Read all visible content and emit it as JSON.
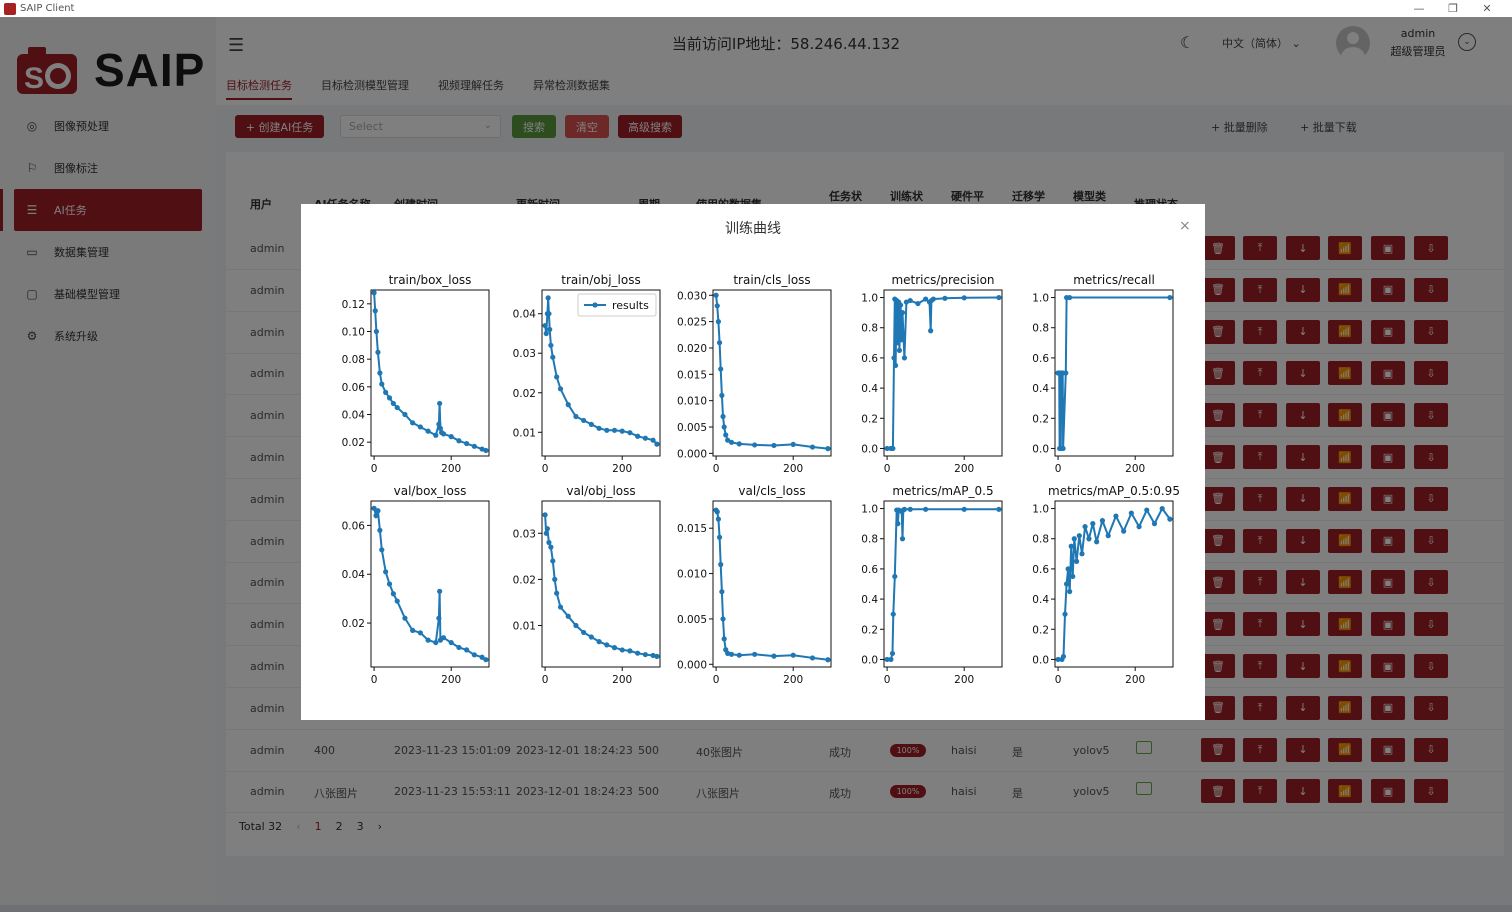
{
  "window": {
    "title": "SAIP Client"
  },
  "brand": {
    "logo_text": "SAIP"
  },
  "sidebar": {
    "items": [
      {
        "label": "图像预处理",
        "icon": "compass-icon"
      },
      {
        "label": "图像标注",
        "icon": "flag-icon"
      },
      {
        "label": "AI任务",
        "icon": "sliders-icon",
        "active": true
      },
      {
        "label": "数据集管理",
        "icon": "presentation-icon"
      },
      {
        "label": "基础模型管理",
        "icon": "folder-icon"
      },
      {
        "label": "系统升级",
        "icon": "gear-icon"
      }
    ]
  },
  "header": {
    "ip_title": "当前访问IP地址：58.246.44.132",
    "language": "中文（简体）",
    "user_name": "admin",
    "user_role": "超级管理员",
    "tabs": [
      "目标检测任务",
      "目标检测模型管理",
      "视频理解任务",
      "异常检测数据集"
    ]
  },
  "toolbar": {
    "create_label": "+ 创建AI任务",
    "select_placeholder": "Select",
    "search_label": "搜索",
    "clear_label": "清空",
    "advanced_label": "高级搜索",
    "batch_delete_label": "+ 批量删除",
    "batch_download_label": "+ 批量下载"
  },
  "table": {
    "columns": [
      "用户",
      "AI任务名称",
      "创建时间",
      "更新时间",
      "周期",
      "使用的数据集",
      "任务状",
      "训练状",
      "硬件平",
      "迁移学",
      "模型类",
      "推理状态"
    ],
    "rows": [
      {
        "user": "admin"
      },
      {
        "user": "admin"
      },
      {
        "user": "admin"
      },
      {
        "user": "admin"
      },
      {
        "user": "admin"
      },
      {
        "user": "admin"
      },
      {
        "user": "admin"
      },
      {
        "user": "admin"
      },
      {
        "user": "admin"
      },
      {
        "user": "admin"
      },
      {
        "user": "admin"
      },
      {
        "user": "admin"
      },
      {
        "user": "admin",
        "name": "400",
        "created": "2023-11-23 15:01:09",
        "updated": "2023-12-01 18:24:23",
        "epochs": "500",
        "dataset": "40张图片",
        "status": "成功",
        "progress": "100%",
        "hardware": "haisi",
        "transfer": "是",
        "model": "yolov5"
      },
      {
        "user": "admin",
        "name": "八张图片",
        "created": "2023-11-23 15:53:11",
        "updated": "2023-12-01 18:24:23",
        "epochs": "500",
        "dataset": "八张图片",
        "status": "成功",
        "progress": "100%",
        "hardware": "haisi",
        "transfer": "是",
        "model": "yolov5"
      }
    ],
    "action_icons": [
      "trash-icon",
      "upload-icon",
      "download-icon",
      "chart-icon",
      "monitor-icon",
      "monitor-download-icon"
    ]
  },
  "pagination": {
    "total": "Total 32",
    "pages": [
      "1",
      "2",
      "3"
    ],
    "current": "1",
    "prev": "‹",
    "next": "›"
  },
  "modal": {
    "title": "训练曲线",
    "close": "×"
  },
  "colors": {
    "primary": "#a11f24",
    "success": "#5b9a3c",
    "plot_line": "#1f77b4"
  },
  "chart_data": [
    {
      "type": "line",
      "title": "train/box_loss",
      "legend": [],
      "ylim": [
        0.01,
        0.13
      ],
      "yticks": [
        0.02,
        0.04,
        0.06,
        0.08,
        0.1,
        0.12
      ],
      "yticklabels": [
        "0.02",
        "0.04",
        "0.06",
        "0.08",
        "0.10",
        "0.12"
      ],
      "xlim": [
        -8,
        298
      ],
      "xticks": [
        0,
        200
      ],
      "x": [
        0,
        3,
        6,
        10,
        15,
        20,
        30,
        40,
        50,
        60,
        80,
        100,
        120,
        140,
        160,
        168,
        170,
        172,
        175,
        180,
        200,
        220,
        240,
        260,
        280,
        290
      ],
      "y": [
        0.128,
        0.115,
        0.1,
        0.085,
        0.07,
        0.062,
        0.056,
        0.052,
        0.048,
        0.045,
        0.04,
        0.034,
        0.031,
        0.028,
        0.025,
        0.033,
        0.048,
        0.03,
        0.027,
        0.026,
        0.024,
        0.021,
        0.019,
        0.017,
        0.015,
        0.014
      ]
    },
    {
      "type": "line",
      "title": "train/obj_loss",
      "legend": [
        "results"
      ],
      "ylim": [
        0.004,
        0.046
      ],
      "yticks": [
        0.01,
        0.02,
        0.03,
        0.04
      ],
      "yticklabels": [
        "0.01",
        "0.02",
        "0.03",
        "0.04"
      ],
      "xlim": [
        -8,
        298
      ],
      "xticks": [
        0,
        200
      ],
      "x": [
        0,
        3,
        6,
        8,
        10,
        12,
        15,
        20,
        30,
        40,
        60,
        80,
        100,
        120,
        140,
        160,
        180,
        200,
        220,
        240,
        260,
        280,
        290
      ],
      "y": [
        0.037,
        0.035,
        0.04,
        0.044,
        0.04,
        0.036,
        0.032,
        0.029,
        0.024,
        0.021,
        0.017,
        0.014,
        0.013,
        0.012,
        0.011,
        0.0105,
        0.0105,
        0.0103,
        0.0099,
        0.009,
        0.0085,
        0.008,
        0.007
      ]
    },
    {
      "type": "line",
      "title": "train/cls_loss",
      "legend": [],
      "ylim": [
        -0.0005,
        0.031
      ],
      "yticks": [
        0,
        0.005,
        0.01,
        0.015,
        0.02,
        0.025,
        0.03
      ],
      "yticklabels": [
        "0.000",
        "0.005",
        "0.010",
        "0.015",
        "0.020",
        "0.025",
        "0.030"
      ],
      "xlim": [
        -8,
        298
      ],
      "xticks": [
        0,
        200
      ],
      "x": [
        0,
        3,
        6,
        9,
        12,
        15,
        18,
        21,
        25,
        30,
        40,
        60,
        100,
        150,
        200,
        250,
        290
      ],
      "y": [
        0.03,
        0.028,
        0.025,
        0.021,
        0.016,
        0.011,
        0.007,
        0.005,
        0.0035,
        0.0025,
        0.0021,
        0.0018,
        0.0016,
        0.0015,
        0.0017,
        0.0012,
        0.0009
      ]
    },
    {
      "type": "line",
      "title": "metrics/precision",
      "legend": [],
      "ylim": [
        -0.05,
        1.05
      ],
      "yticks": [
        0,
        0.2,
        0.4,
        0.6,
        0.8,
        1.0
      ],
      "yticklabels": [
        "0.0",
        "0.2",
        "0.4",
        "0.6",
        "0.8",
        "1.0"
      ],
      "xlim": [
        -8,
        298
      ],
      "xticks": [
        0,
        200
      ],
      "x": [
        0,
        10,
        15,
        18,
        20,
        22,
        25,
        28,
        30,
        32,
        35,
        38,
        40,
        45,
        50,
        60,
        80,
        100,
        110,
        113,
        115,
        120,
        150,
        200,
        290
      ],
      "y": [
        0,
        0,
        0,
        0.6,
        0.99,
        0.55,
        0.98,
        0.7,
        0.97,
        0.65,
        0.95,
        0.72,
        0.9,
        0.6,
        0.97,
        0.98,
        0.96,
        0.99,
        0.97,
        0.78,
        0.98,
        0.99,
        0.995,
        0.998,
        1.0
      ]
    },
    {
      "type": "line",
      "title": "metrics/recall",
      "legend": [],
      "ylim": [
        -0.05,
        1.05
      ],
      "yticks": [
        0,
        0.2,
        0.4,
        0.6,
        0.8,
        1.0
      ],
      "yticklabels": [
        "0.0",
        "0.2",
        "0.4",
        "0.6",
        "0.8",
        "1.0"
      ],
      "xlim": [
        -8,
        298
      ],
      "xticks": [
        0,
        200
      ],
      "x": [
        0,
        3,
        4,
        7,
        8,
        12,
        13,
        20,
        22,
        30,
        290
      ],
      "y": [
        0.5,
        0.5,
        0,
        0,
        0.5,
        0.5,
        0,
        0.5,
        1,
        1,
        1
      ]
    },
    {
      "type": "line",
      "title": "val/box_loss",
      "legend": [],
      "ylim": [
        0.002,
        0.07
      ],
      "yticks": [
        0.02,
        0.04,
        0.06
      ],
      "yticklabels": [
        "0.02",
        "0.04",
        "0.06"
      ],
      "xlim": [
        -8,
        298
      ],
      "xticks": [
        0,
        200
      ],
      "x": [
        0,
        5,
        10,
        15,
        20,
        30,
        40,
        50,
        60,
        80,
        100,
        120,
        140,
        160,
        168,
        170,
        172,
        180,
        200,
        220,
        240,
        260,
        280,
        290
      ],
      "y": [
        0.067,
        0.064,
        0.066,
        0.058,
        0.05,
        0.041,
        0.036,
        0.032,
        0.029,
        0.022,
        0.017,
        0.016,
        0.013,
        0.012,
        0.022,
        0.033,
        0.013,
        0.014,
        0.012,
        0.01,
        0.009,
        0.007,
        0.006,
        0.005
      ]
    },
    {
      "type": "line",
      "title": "val/obj_loss",
      "legend": [],
      "ylim": [
        0.001,
        0.037
      ],
      "yticks": [
        0.01,
        0.02,
        0.03
      ],
      "yticklabels": [
        "0.01",
        "0.02",
        "0.03"
      ],
      "xlim": [
        -8,
        298
      ],
      "xticks": [
        0,
        200
      ],
      "x": [
        0,
        3,
        6,
        10,
        15,
        20,
        25,
        30,
        40,
        60,
        80,
        100,
        120,
        140,
        160,
        180,
        200,
        220,
        240,
        260,
        280,
        290
      ],
      "y": [
        0.034,
        0.03,
        0.031,
        0.028,
        0.027,
        0.024,
        0.02,
        0.017,
        0.014,
        0.012,
        0.01,
        0.0085,
        0.0075,
        0.0065,
        0.0058,
        0.0052,
        0.0047,
        0.0045,
        0.004,
        0.0037,
        0.0035,
        0.0033
      ]
    },
    {
      "type": "line",
      "title": "val/cls_loss",
      "legend": [],
      "ylim": [
        -0.0003,
        0.018
      ],
      "yticks": [
        0,
        0.005,
        0.01,
        0.015
      ],
      "yticklabels": [
        "0.000",
        "0.005",
        "0.010",
        "0.015"
      ],
      "xlim": [
        -8,
        298
      ],
      "xticks": [
        0,
        200
      ],
      "x": [
        0,
        3,
        6,
        9,
        12,
        15,
        18,
        21,
        25,
        30,
        40,
        60,
        100,
        150,
        200,
        250,
        290
      ],
      "y": [
        0.017,
        0.0168,
        0.016,
        0.014,
        0.011,
        0.008,
        0.005,
        0.0028,
        0.0016,
        0.0012,
        0.0011,
        0.001,
        0.0011,
        0.0009,
        0.001,
        0.0007,
        0.0005
      ]
    },
    {
      "type": "line",
      "title": "metrics/mAP_0.5",
      "legend": [],
      "ylim": [
        -0.05,
        1.05
      ],
      "yticks": [
        0,
        0.2,
        0.4,
        0.6,
        0.8,
        1.0
      ],
      "yticklabels": [
        "0.0",
        "0.2",
        "0.4",
        "0.6",
        "0.8",
        "1.0"
      ],
      "xlim": [
        -8,
        298
      ],
      "xticks": [
        0,
        200
      ],
      "x": [
        0,
        10,
        14,
        16,
        20,
        25,
        28,
        30,
        38,
        40,
        42,
        45,
        60,
        100,
        200,
        290
      ],
      "y": [
        0,
        0,
        0.04,
        0.3,
        0.55,
        0.99,
        0.9,
        0.99,
        0.98,
        0.8,
        0.99,
        0.995,
        0.995,
        0.995,
        0.995,
        0.995
      ]
    },
    {
      "type": "line",
      "title": "metrics/mAP_0.5:0.95",
      "legend": [],
      "ylim": [
        -0.05,
        1.05
      ],
      "yticks": [
        0,
        0.2,
        0.4,
        0.6,
        0.8,
        1.0
      ],
      "yticklabels": [
        "0.0",
        "0.2",
        "0.4",
        "0.6",
        "0.8",
        "1.0"
      ],
      "xlim": [
        -8,
        298
      ],
      "xticks": [
        0,
        200
      ],
      "x": [
        0,
        10,
        14,
        18,
        22,
        26,
        30,
        34,
        38,
        42,
        48,
        55,
        62,
        70,
        80,
        90,
        100,
        115,
        130,
        150,
        170,
        190,
        210,
        230,
        250,
        270,
        290
      ],
      "y": [
        0,
        0,
        0.02,
        0.3,
        0.5,
        0.6,
        0.45,
        0.75,
        0.55,
        0.8,
        0.65,
        0.82,
        0.7,
        0.88,
        0.8,
        0.9,
        0.78,
        0.92,
        0.82,
        0.95,
        0.85,
        0.97,
        0.88,
        0.99,
        0.9,
        1.0,
        0.93
      ]
    }
  ]
}
